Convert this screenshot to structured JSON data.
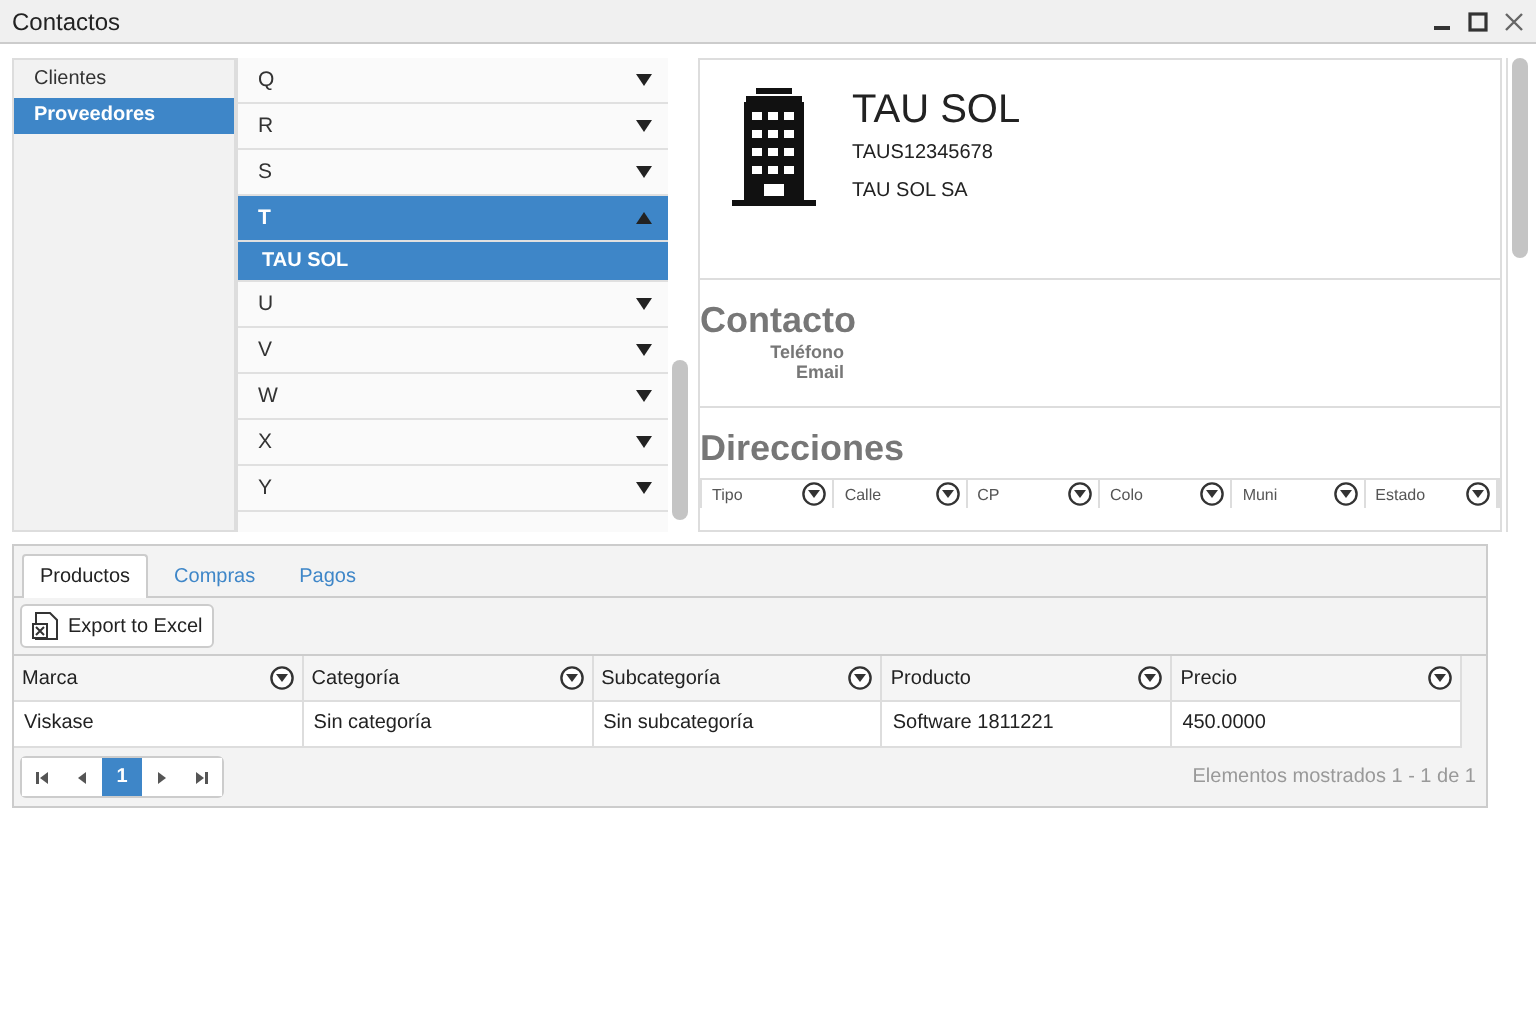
{
  "window": {
    "title": "Contactos"
  },
  "sidebar": {
    "items": [
      {
        "label": "Clientes",
        "selected": false
      },
      {
        "label": "Proveedores",
        "selected": true
      }
    ]
  },
  "letters": [
    {
      "label": "Q",
      "expanded": false
    },
    {
      "label": "R",
      "expanded": false
    },
    {
      "label": "S",
      "expanded": false
    },
    {
      "label": "T",
      "expanded": true,
      "children": [
        {
          "label": "TAU SOL",
          "selected": true
        }
      ]
    },
    {
      "label": "U",
      "expanded": false
    },
    {
      "label": "V",
      "expanded": false
    },
    {
      "label": "W",
      "expanded": false
    },
    {
      "label": "X",
      "expanded": false
    },
    {
      "label": "Y",
      "expanded": false
    }
  ],
  "detail": {
    "name": "TAU SOL",
    "code": "TAUS12345678",
    "legal_name": "TAU SOL SA",
    "contact": {
      "heading": "Contacto",
      "fields": [
        "Teléfono",
        "Email"
      ]
    },
    "addresses": {
      "heading": "Direcciones",
      "columns": [
        "Tipo",
        "Calle",
        "CP",
        "Colo",
        "Muni",
        "Estado"
      ]
    }
  },
  "tabs": [
    {
      "label": "Productos",
      "selected": true
    },
    {
      "label": "Compras",
      "selected": false
    },
    {
      "label": "Pagos",
      "selected": false
    }
  ],
  "export_button": "Export to Excel",
  "table": {
    "columns": [
      "Marca",
      "Categoría",
      "Subcategoría",
      "Producto",
      "Precio"
    ],
    "rows": [
      [
        "Viskase",
        "Sin categoría",
        "Sin subcategoría",
        "Software 1811221",
        "450.0000"
      ]
    ]
  },
  "pager": {
    "pages": [
      {
        "label": "1",
        "selected": true
      }
    ],
    "summary": "Elementos mostrados 1 - 1 de 1"
  }
}
